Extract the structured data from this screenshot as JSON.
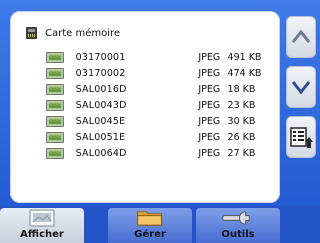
{
  "header": {
    "title": "Carte mémoire"
  },
  "files": [
    {
      "name": "03170001",
      "type": "JPEG",
      "size": "491 KB"
    },
    {
      "name": "03170002",
      "type": "JPEG",
      "size": "474 KB"
    },
    {
      "name": "SAL0016D",
      "type": "JPEG",
      "size": "18 KB"
    },
    {
      "name": "SAL0043D",
      "type": "JPEG",
      "size": "23 KB"
    },
    {
      "name": "SAL0045E",
      "type": "JPEG",
      "size": "30 KB"
    },
    {
      "name": "SAL0051E",
      "type": "JPEG",
      "size": "26 KB"
    },
    {
      "name": "SAL0064D",
      "type": "JPEG",
      "size": "27 KB"
    }
  ],
  "tabs": [
    {
      "label": "Afficher"
    },
    {
      "label": "Gérer"
    },
    {
      "label": "Outils"
    }
  ],
  "icons": {
    "header": "memory-card-icon",
    "file": "image-file-icon",
    "nav_up": "arrow-up-icon",
    "nav_down": "arrow-down-icon",
    "nav_list": "list-export-icon",
    "tab_afficher": "image-viewer-icon",
    "tab_gerer": "folder-icon",
    "tab_outils": "wrench-icon"
  }
}
